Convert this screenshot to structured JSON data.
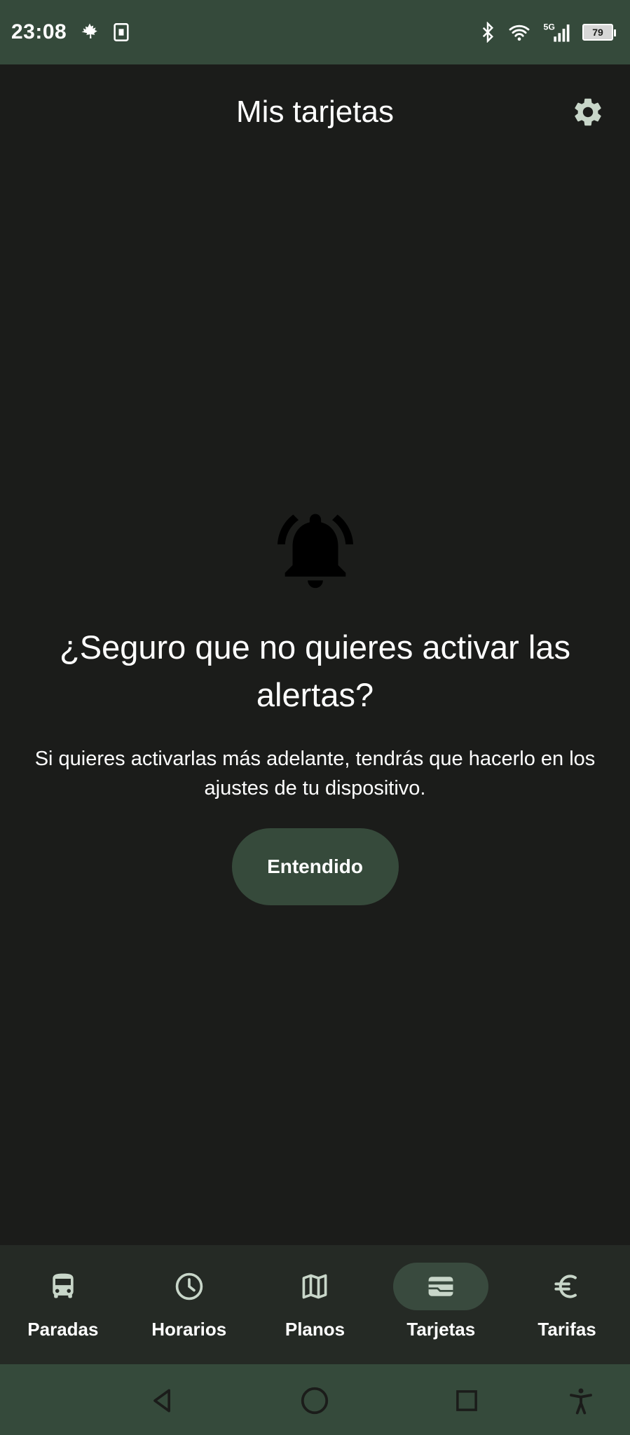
{
  "status_bar": {
    "time": "23:08",
    "battery": "79",
    "network": "5G"
  },
  "header": {
    "title": "Mis tarjetas"
  },
  "dialog": {
    "heading": "¿Seguro que no quieres activar las alertas?",
    "message": "Si quieres activarlas más adelante, tendrás que hacerlo en los ajustes de tu dispositivo.",
    "button_label": "Entendido"
  },
  "bottom_nav": {
    "items": [
      {
        "label": "Paradas",
        "icon": "bus-icon",
        "active": false
      },
      {
        "label": "Horarios",
        "icon": "clock-icon",
        "active": false
      },
      {
        "label": "Planos",
        "icon": "map-icon",
        "active": false
      },
      {
        "label": "Tarjetas",
        "icon": "card-icon",
        "active": true
      },
      {
        "label": "Tarifas",
        "icon": "euro-icon",
        "active": false
      }
    ]
  },
  "colors": {
    "background": "#1b1c1a",
    "status_bar": "#354a3b",
    "button": "#364a3b",
    "nav_bar": "#252a25",
    "icon": "#c8d6c9"
  }
}
